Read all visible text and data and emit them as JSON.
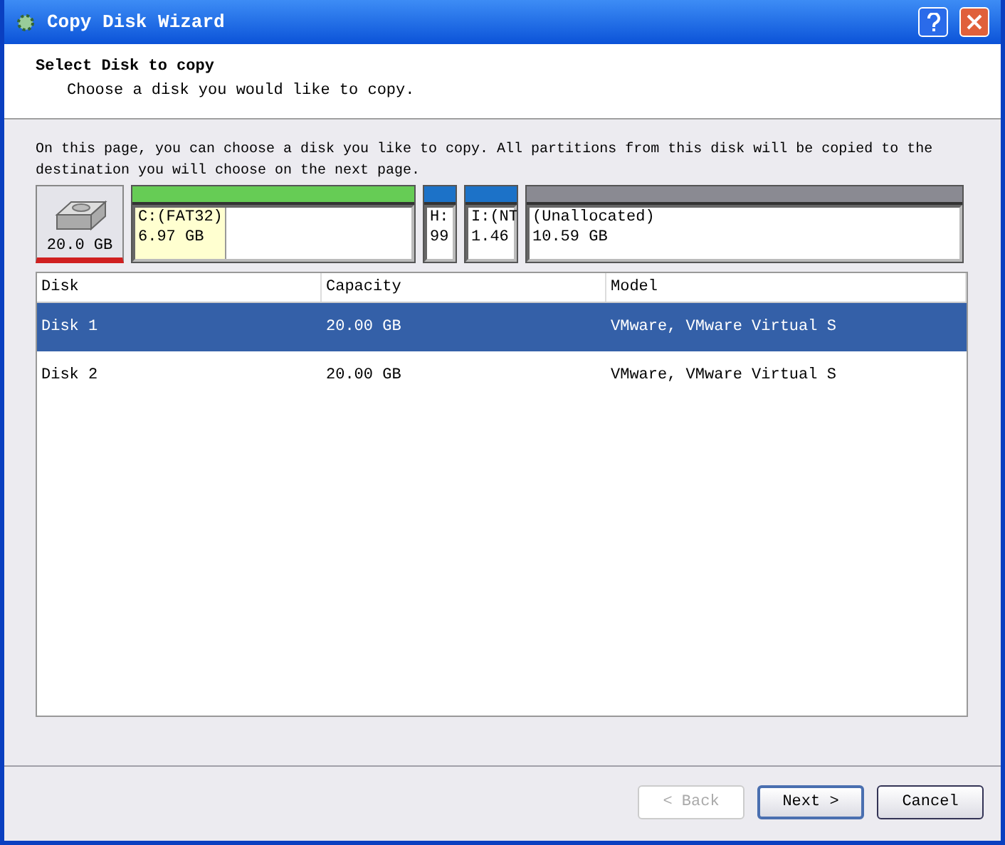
{
  "window": {
    "title": "Copy Disk Wizard"
  },
  "header": {
    "title": "Select Disk to copy",
    "subtitle": "Choose a disk you would like to copy."
  },
  "description": "On this page, you can choose a disk you like to copy. All partitions from this disk will be copied to the destination you will choose on the next page.",
  "disk_map": {
    "disk": {
      "size": "20.0 GB",
      "selected": true
    },
    "partitions": [
      {
        "label": "C:(FAT32)",
        "size": "6.97 GB",
        "color": "#66cc55",
        "selected": true
      },
      {
        "label": "H:",
        "size": "99",
        "color": "#1c72c8",
        "selected": false
      },
      {
        "label": "I:(NT",
        "size": "1.46",
        "color": "#1c72c8",
        "selected": false
      },
      {
        "label": "(Unallocated)",
        "size": "10.59 GB",
        "color": "#8a8a92",
        "selected": false
      }
    ]
  },
  "table": {
    "columns": [
      "Disk",
      "Capacity",
      "Model"
    ],
    "rows": [
      {
        "cells": [
          "Disk 1",
          "20.00 GB",
          "VMware, VMware Virtual S"
        ],
        "selected": true
      },
      {
        "cells": [
          "Disk 2",
          "20.00 GB",
          "VMware, VMware Virtual S"
        ],
        "selected": false
      }
    ]
  },
  "buttons": [
    {
      "label": "< Back",
      "disabled": true,
      "default": false
    },
    {
      "label": "Next >",
      "disabled": false,
      "default": true
    },
    {
      "label": "Cancel",
      "disabled": false,
      "default": false
    }
  ]
}
